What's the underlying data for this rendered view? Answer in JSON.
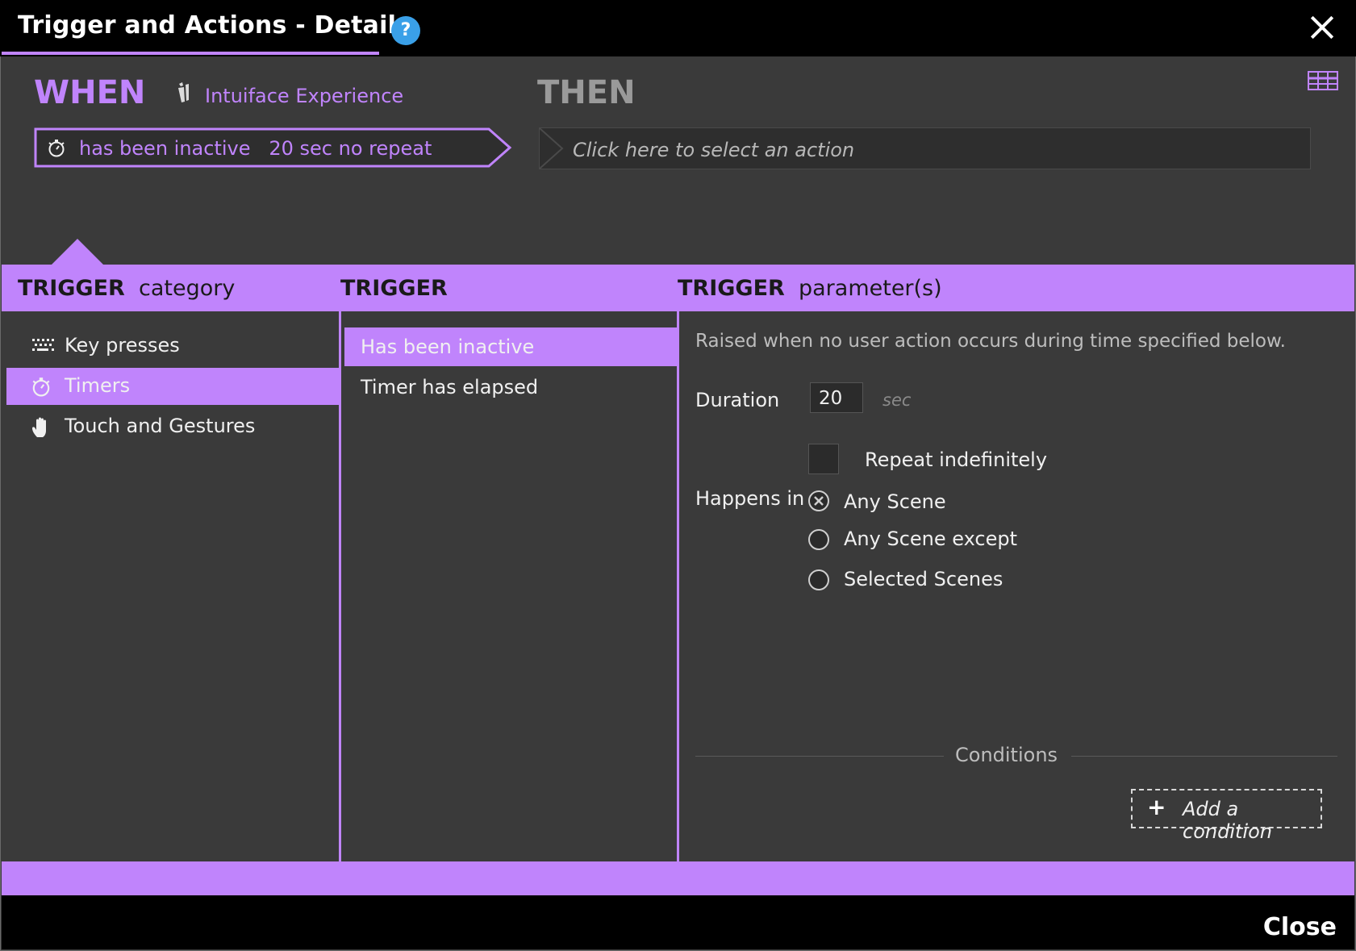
{
  "window": {
    "title": "Trigger and Actions - Details",
    "help_symbol": "?",
    "close_footer_label": "Close"
  },
  "when": {
    "label": "WHEN",
    "source_label": "Intuiface Experience",
    "trigger_summary": "has been inactive   20 sec no repeat"
  },
  "then": {
    "label": "THEN",
    "action_placeholder": "Click here to select an action"
  },
  "headers": {
    "category_bold": "TRIGGER",
    "category_rest": "category",
    "trigger_bold": "TRIGGER",
    "params_bold": "TRIGGER",
    "params_rest": "parameter(s)"
  },
  "categories": [
    {
      "label": "Key presses",
      "icon": "keyboard-icon",
      "selected": false
    },
    {
      "label": "Timers",
      "icon": "stopwatch-icon",
      "selected": true
    },
    {
      "label": "Touch and Gestures",
      "icon": "hand-icon",
      "selected": false
    }
  ],
  "triggers": [
    {
      "label": "Has been inactive",
      "selected": true
    },
    {
      "label": "Timer has elapsed",
      "selected": false
    }
  ],
  "params": {
    "description": "Raised when no user action occurs during time specified below.",
    "duration_label": "Duration",
    "duration_value": "20",
    "duration_unit": "sec",
    "repeat_label": "Repeat indefinitely",
    "repeat_checked": false,
    "happens_in_label": "Happens in",
    "scene_options": [
      {
        "label": "Any Scene",
        "selected": true
      },
      {
        "label": "Any Scene except",
        "selected": false
      },
      {
        "label": "Selected Scenes",
        "selected": false
      }
    ],
    "conditions_label": "Conditions",
    "add_condition_label": "Add a condition"
  },
  "colors": {
    "accent": "#c084fc",
    "background": "#3a3a3a",
    "titlebar": "#000000",
    "help": "#3aa0e8"
  }
}
